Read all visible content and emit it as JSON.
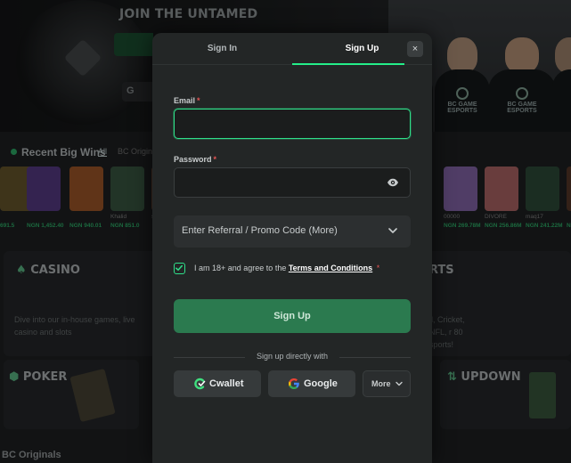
{
  "background": {
    "hero_title": "JOIN THE UNTAMED",
    "hero_google_label": "G",
    "team_logo_text": "BC GAME\nESPORTS",
    "recent_wins": {
      "title": "Recent Big Wins",
      "tab_all": "All",
      "tab_originals": "BC Origina",
      "items": [
        {
          "label": "",
          "amount": "691.5",
          "color": "#6b5a2e"
        },
        {
          "label": "",
          "amount": "NGN 1,452.40",
          "color": "#5a3d8a"
        },
        {
          "label": "",
          "amount": "NGN 940.01",
          "color": "#a55a2a"
        },
        {
          "label": "Khalid",
          "amount": "NGN 851.0",
          "color": "#3b5a44"
        },
        {
          "label": "sebraq",
          "amount": "",
          "color": "#6a4a3a"
        },
        {
          "label": "00000",
          "amount": "NGN 269.78M",
          "color": "#8a6ab0"
        },
        {
          "label": "DIVORE",
          "amount": "NGN 256.86M",
          "color": "#b56a6a"
        },
        {
          "label": "maq17",
          "amount": "NGN 241.22M",
          "color": "#2f4f3b"
        },
        {
          "label": "",
          "amount": "NGN",
          "color": "#5a3a2a"
        }
      ]
    },
    "casino": {
      "title": "CASINO",
      "desc": "Dive into our in-house games, live casino and slots"
    },
    "sports": {
      "title": "RTS",
      "desc": "ll, Cricket, NFL, r 80 sports!"
    },
    "poker": {
      "title": "POKER"
    },
    "updown": {
      "title": "UPDOWN"
    },
    "bottom_label": "BC Originals"
  },
  "modal": {
    "tabs": [
      {
        "label": "Sign In",
        "active": false
      },
      {
        "label": "Sign Up",
        "active": true
      }
    ],
    "close_label": "×",
    "email": {
      "label": "Email",
      "required": "*",
      "value": "",
      "placeholder": ""
    },
    "password": {
      "label": "Password",
      "required": "*",
      "value": "",
      "placeholder": ""
    },
    "promo": {
      "label": "Enter Referral / Promo Code (More)"
    },
    "terms": {
      "checked": true,
      "prefix": "I am 18+ and agree to the",
      "link": "Terms and Conditions",
      "required": "*"
    },
    "submit_label": "Sign Up",
    "social_divider": "Sign up directly with",
    "social": {
      "cwallet": "Cwallet",
      "google": "Google",
      "more": "More"
    }
  },
  "colors": {
    "accent": "#24ee89",
    "button": "#2b7a4f",
    "modal_bg": "#232626",
    "required": "#e35454"
  }
}
